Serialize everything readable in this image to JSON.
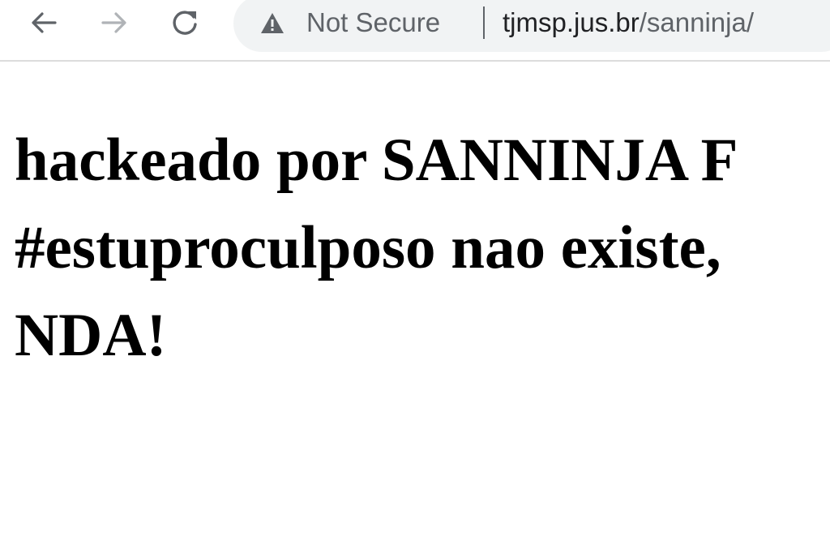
{
  "browser": {
    "security_label": "Not Secure",
    "url_host": "tjmsp.jus.br",
    "url_path": "/sanninja/",
    "icons": {
      "back": "arrow-left-icon",
      "forward": "arrow-right-icon",
      "reload": "reload-icon",
      "security": "warning-triangle-icon"
    }
  },
  "page": {
    "lines": [
      "hackeado por SANNINJA F",
      "#estuproculposo nao existe,",
      "NDA!"
    ]
  }
}
